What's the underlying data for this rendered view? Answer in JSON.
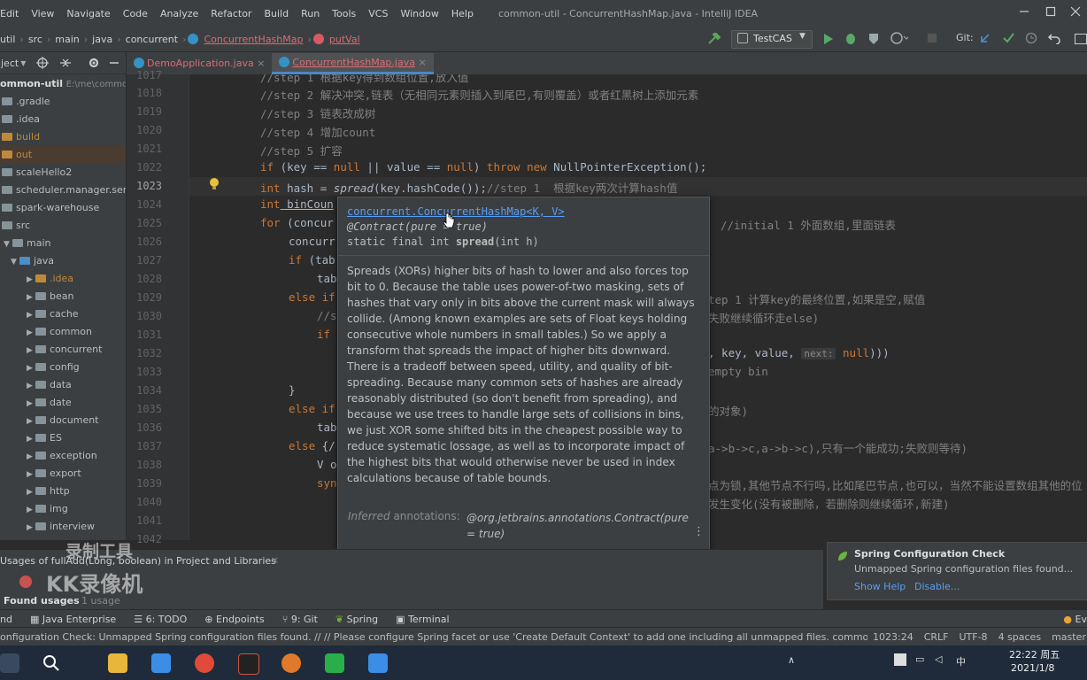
{
  "menu": [
    "Edit",
    "View",
    "Navigate",
    "Code",
    "Analyze",
    "Refactor",
    "Build",
    "Run",
    "Tools",
    "VCS",
    "Window",
    "Help"
  ],
  "window_title": "common-util - ConcurrentHashMap.java - IntelliJ IDEA",
  "breadcrumbs": [
    "util",
    "src",
    "main",
    "java",
    "concurrent",
    "ConcurrentHashMap",
    "putVal"
  ],
  "run_config": "TestCAS",
  "git_label": "Git:",
  "sidebar": {
    "header": "ject",
    "root_name": "ommon-util",
    "root_path": "E:\\me\\commo",
    "items": [
      ".gradle",
      ".idea",
      "build",
      "out",
      "scaleHello2",
      "scheduler.manager.server.l",
      "spark-warehouse",
      "src",
      "main",
      "java",
      ".idea",
      "bean",
      "cache",
      "common",
      "concurrent",
      "config",
      "data",
      "date",
      "document",
      "ES",
      "exception",
      "export",
      "http",
      "img",
      "interview",
      "io"
    ]
  },
  "tabs": [
    "DemoApplication.java",
    "ConcurrentHashMap.java"
  ],
  "code": {
    "lines": [
      "1017",
      "1018",
      "1019",
      "1020",
      "1021",
      "1022",
      "1023",
      "1024",
      "1025",
      "1026",
      "1027",
      "1028",
      "1029",
      "1030",
      "1031",
      "1032",
      "1033",
      "1034",
      "1035",
      "1036",
      "1037",
      "1038",
      "1039",
      "1040",
      "1041",
      "1042"
    ],
    "l1017": "//step 1 根据key得到数组位置,放入值",
    "l1018": "//step 2 解决冲突,链表（无相同元素则插入到尾巴,有则覆盖）或者红黑树上添加元素",
    "l1019": "//step 3 链表改成树",
    "l1020": "//step 4 增加count",
    "l1021": "//step 5 扩容",
    "l1022a": "if",
    "l1022b": " (key == ",
    "l1022c": "null",
    "l1022d": " || value == ",
    "l1022e": "null",
    "l1022f": ") ",
    "l1022g": "throw new",
    "l1022h": " NullPointerException();",
    "l1023a": "int",
    "l1023b": " hash = ",
    "l1023c": "spread",
    "l1023d": "(key.hashCode());",
    "l1023e": "//step 1  根据key两次计算hash值",
    "l1024a": "int",
    "l1024b": " binCoun",
    "l1025a": "for",
    "l1025b": " (concur",
    "l1025c": "//initial 1 外面数组,里面链表",
    "l1026": "concurr",
    "l1027a": "if",
    "l1027b": " (tab",
    "l1028": "tab",
    "l1029a": "else if",
    "l1029c": "tep 1 计算key的最终位置,如果是空,赋值",
    "l1030a": "//s",
    "l1030c": "失败继续循环走else)",
    "l1031a": "if",
    "l1032a": ", key, value, ",
    "l1032hint": "next:",
    "l1032b": "null",
    "l1032c": ")))",
    "l1033c": "empty bin",
    "l1034": "}",
    "l1035a": "else if",
    "l1035c": "的对象)",
    "l1036": "tab",
    "l1037a": "else",
    "l1037b": " {/",
    "l1037c": "a->b->c,a->b->c),只有一个能成功;失败则等待)",
    "l1038": "V o",
    "l1039": "syn",
    "l1039c": "点为锁,其他节点不行吗,比如尾巴节点,也可以，当然不能设置数组其他的位",
    "l1040c": "发生变化(没有被删除，若删除则继续循环,新建)"
  },
  "popup": {
    "class_link": "concurrent.ConcurrentHashMap<K, V>",
    "annotation": "@Contract(pure = true)",
    "signature_pre": "static final int ",
    "signature_name": "spread",
    "signature_post": "(int h)",
    "description": "Spreads (XORs) higher bits of hash to lower and also forces top bit to 0. Because the table uses power-of-two masking, sets of hashes that vary only in bits above the current mask will always collide. (Among known examples are sets of Float keys holding consecutive whole numbers in small tables.) So we apply a transform that spreads the impact of higher bits downward. There is a tradeoff between speed, utility, and quality of bit-spreading. Because many common sets of hashes are already reasonably distributed (so don't benefit from spreading), and because we use trees to handle large sets of collisions in bins, we just XOR some shifted bits in the cheapest possible way to reduce systematic lossage, as well as to incorporate impact of the highest bits that would otherwise never be used in index calculations because of table bounds.",
    "footer_label": "Inferred",
    "footer_label2": "annotations:",
    "footer_value": "@org.jetbrains.annotations.Contract(pure = true)"
  },
  "find": {
    "title": "Usages of fullAdd(Long, boolean) in Project and Libraries",
    "found_label": "Found usages",
    "found_count": "1 usage"
  },
  "watermark": {
    "line1": "录制工具",
    "line2": "KK录像机"
  },
  "notification": {
    "title": "Spring Configuration Check",
    "message": "Unmapped Spring configuration files found...",
    "show_help": "Show Help",
    "disable": "Disable..."
  },
  "toolwindows": [
    "nd",
    "Java Enterprise",
    "6: TODO",
    "Endpoints",
    "9: Git",
    "Spring",
    "Terminal",
    "Ev"
  ],
  "status": {
    "message": "onfiguration Check: Unmapped Spring configuration files found. // // Please configure Spring facet or use 'Create Default Context' to add one including all unmapped files. common-util (8 fi... (today 17:55)",
    "position": "1023:24",
    "line_sep": "CRLF",
    "encoding": "UTF-8",
    "indent": "4 spaces",
    "branch": "master"
  },
  "taskbar": {
    "time": "22:22 周五",
    "date": "2021/1/8",
    "ime": "中"
  },
  "colors": {
    "accent": "#4a88c7",
    "link": "#589df6",
    "keyword": "#cc7832",
    "method": "#ffc66d",
    "comment": "#808080",
    "error_file": "#d96c72"
  }
}
